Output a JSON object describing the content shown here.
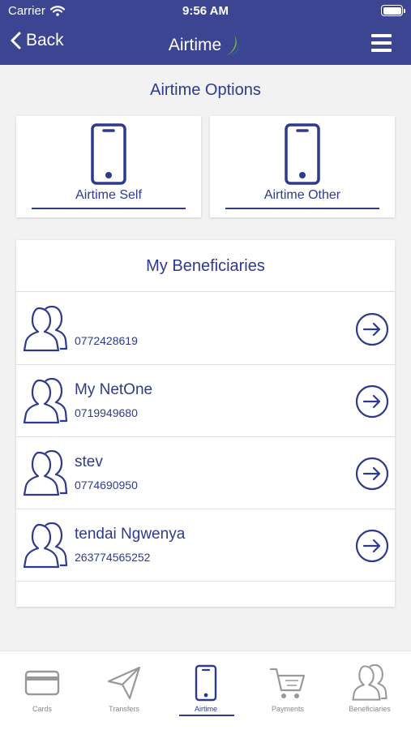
{
  "status_bar": {
    "carrier": "Carrier",
    "time": "9:56 AM"
  },
  "nav": {
    "back_label": "Back",
    "title": "Airtime"
  },
  "airtime_options": {
    "title": "Airtime Options",
    "options": [
      {
        "label": "Airtime Self"
      },
      {
        "label": "Airtime Other"
      }
    ]
  },
  "beneficiaries": {
    "title": "My Beneficiaries",
    "items": [
      {
        "name": "",
        "phone": "0772428619"
      },
      {
        "name": "My NetOne",
        "phone": "0719949680"
      },
      {
        "name": "stev",
        "phone": "0774690950"
      },
      {
        "name": "tendai Ngwenya",
        "phone": "263774565252"
      }
    ]
  },
  "tabs": [
    {
      "label": "Cards",
      "icon": "card-icon"
    },
    {
      "label": "Transfers",
      "icon": "paper-plane-icon"
    },
    {
      "label": "Airtime",
      "icon": "mobile-phone-icon",
      "active": true
    },
    {
      "label": "Payments",
      "icon": "cart-icon"
    },
    {
      "label": "Beneficiaries",
      "icon": "users-icon"
    }
  ],
  "colors": {
    "header_bg": "#3b4591",
    "accent": "#2e3a8c",
    "logo_green": "#7cc242"
  }
}
